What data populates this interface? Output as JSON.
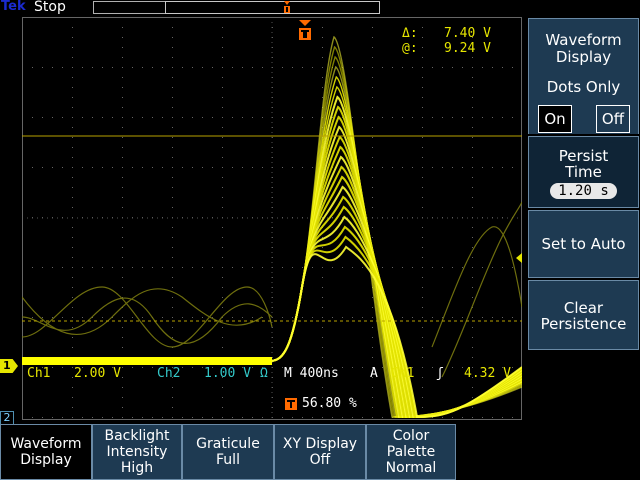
{
  "top_bar": {
    "logo_t": "Tek",
    "logo_e": "",
    "run_status": "Stop"
  },
  "readouts": {
    "delta_label": "Δ:",
    "delta_value": "7.40 V",
    "at_label": "@:",
    "at_value": "9.24 V"
  },
  "channel_bar": {
    "ch1_marker": "1",
    "ch1_label": "Ch1",
    "ch1_scale": "2.00 V",
    "ch2_label": "Ch2",
    "ch2_scale": "1.00 V",
    "ch2_coupling": "Ω",
    "timebase": "M 400ns",
    "trigger_mode": "A",
    "trigger_source": "Ch1",
    "trigger_slope": "ʃ",
    "trigger_level": "4.32 V",
    "trigger_position": "56.80 %"
  },
  "side_menu": {
    "waveform_display_title_1": "Waveform",
    "waveform_display_title_2": "Display",
    "dots_only_label": "Dots Only",
    "on_label": "On",
    "off_label": "Off",
    "persist_time_1": "Persist",
    "persist_time_2": "Time",
    "persist_value": "1.20 s",
    "set_to_auto": "Set to Auto",
    "clear_persistence_1": "Clear",
    "clear_persistence_2": "Persistence"
  },
  "bottom_menu": {
    "menu_number": "2",
    "items": [
      {
        "l1": "Waveform",
        "l2": "Display",
        "l3": ""
      },
      {
        "l1": "Backlight",
        "l2": "Intensity",
        "l3": "High"
      },
      {
        "l1": "Graticule",
        "l2": "Full",
        "l3": ""
      },
      {
        "l1": "XY Display",
        "l2": "Off",
        "l3": ""
      },
      {
        "l1": "Color",
        "l2": "Palette",
        "l3": "Normal"
      }
    ]
  },
  "colors": {
    "trace": "#ffff00",
    "trace_dim": "#8a8a1a",
    "cursor": "#b8a200",
    "menu_bg": "#1e3a52",
    "trigger_orange": "#ff6a00",
    "ch2_cyan": "#33c9c9"
  }
}
